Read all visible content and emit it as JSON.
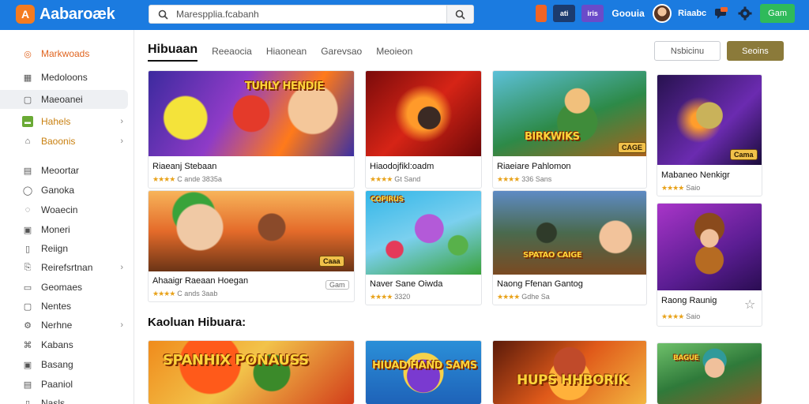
{
  "header": {
    "logo_glyph": "A",
    "logo_text": "Aabaroæk",
    "search_placeholder": "Marespplia.fcabanh",
    "icons": {
      "t1": "",
      "t2": "ati",
      "t3": "iris",
      "brand": "Goouia"
    },
    "user_name": "Riaabc",
    "green_button": "Gam"
  },
  "sidebar": {
    "items": [
      {
        "label": "Markwoads",
        "icon": "target-icon",
        "glyph": "◎"
      },
      {
        "label": "Medoloons",
        "icon": "grid-icon",
        "glyph": "▦"
      },
      {
        "label": "Maeoanei",
        "icon": "square-icon",
        "glyph": "▢"
      },
      {
        "label": "Hahels",
        "icon": "flag-icon",
        "glyph": "▬"
      },
      {
        "label": "Baoonis",
        "icon": "tag-icon",
        "glyph": "⌂"
      },
      {
        "label": "Meoortar",
        "icon": "calendar-icon",
        "glyph": "▤"
      },
      {
        "label": "Ganoka",
        "icon": "circle-icon",
        "glyph": "◯"
      },
      {
        "label": "Woaecin",
        "icon": "ring-icon",
        "glyph": "◌"
      },
      {
        "label": "Moneri",
        "icon": "list-icon",
        "glyph": "▣"
      },
      {
        "label": "Reiign",
        "icon": "document-icon",
        "glyph": "▯"
      },
      {
        "label": "Reirefsrtnan",
        "icon": "link-icon",
        "glyph": "⎘"
      },
      {
        "label": "Geomaes",
        "icon": "gamepad-icon",
        "glyph": "▭"
      },
      {
        "label": "Nentes",
        "icon": "note-icon",
        "glyph": "▢"
      },
      {
        "label": "Nerhne",
        "icon": "settings-icon",
        "glyph": "⚙"
      },
      {
        "label": "Kabans",
        "icon": "box-icon",
        "glyph": "⌘"
      },
      {
        "label": "Basang",
        "icon": "folder-icon",
        "glyph": "▣"
      },
      {
        "label": "Paaniol",
        "icon": "panel-icon",
        "glyph": "▤"
      },
      {
        "label": "Nasls",
        "icon": "nail-icon",
        "glyph": "▯"
      }
    ]
  },
  "main": {
    "tabs": [
      "Hibuaan",
      "Reeaocia",
      "Hiaonean",
      "Garevsao",
      "Meoieon"
    ],
    "outline_button": "Nsbicinu",
    "gold_button": "Seoins",
    "section_title": "Kaoluan Hibuara:",
    "cards": [
      {
        "title": "Riaeanj Stebaan",
        "meta": "C ande 3835a",
        "stars": "★★★★",
        "art_text": "TUHLY HENDIE"
      },
      {
        "title": "Hiaodojfikl:oadm",
        "meta": "Gt Sand",
        "stars": "★★★★",
        "art_text": ""
      },
      {
        "title": "Riaeiare Pahlomon",
        "meta": "336 Sans",
        "stars": "★★★★",
        "art_text": "BIRKWIKS",
        "badge": "CAGE"
      },
      {
        "title": "Mabaneo Nenkigr",
        "meta": "Saio",
        "stars": "★★★★",
        "art_text": "",
        "badge": "Cama"
      },
      {
        "title": "Ahaaigr Raeaan Hoegan",
        "meta": "C ands 3aab",
        "stars": "★★★★",
        "art_text": "",
        "badge": "Caaa"
      },
      {
        "title": "Naver Sane Oiwda",
        "meta": "3320",
        "stars": "★★★★",
        "art_text": "COPIRUS"
      },
      {
        "title": "Naong Ffenan Gantog",
        "meta": "Gdhe Sa",
        "stars": "★★★★",
        "art_text": "SPATAO CAIGE"
      },
      {
        "title": "Raong Raunig",
        "meta": "Saio",
        "stars": "★★★★",
        "art_text": ""
      },
      {
        "title": "",
        "meta": "",
        "stars": "",
        "art_text": "SPANHIX PONAUSS"
      },
      {
        "title": "",
        "meta": "",
        "stars": "",
        "art_text": "HIUAD HAND SAMS"
      },
      {
        "title": "",
        "meta": "",
        "stars": "",
        "art_text": "HUPS HHBORIK"
      },
      {
        "title": "",
        "meta": "",
        "stars": "",
        "art_text": "BAGUE"
      }
    ],
    "card5_grey_badge": "Gam"
  },
  "colors": {
    "topbar": "#1b7be0",
    "accent_orange": "#e0641f",
    "gold_button": "#8b7a3a",
    "green_button": "#2fba5a",
    "star": "#e8a21a"
  }
}
